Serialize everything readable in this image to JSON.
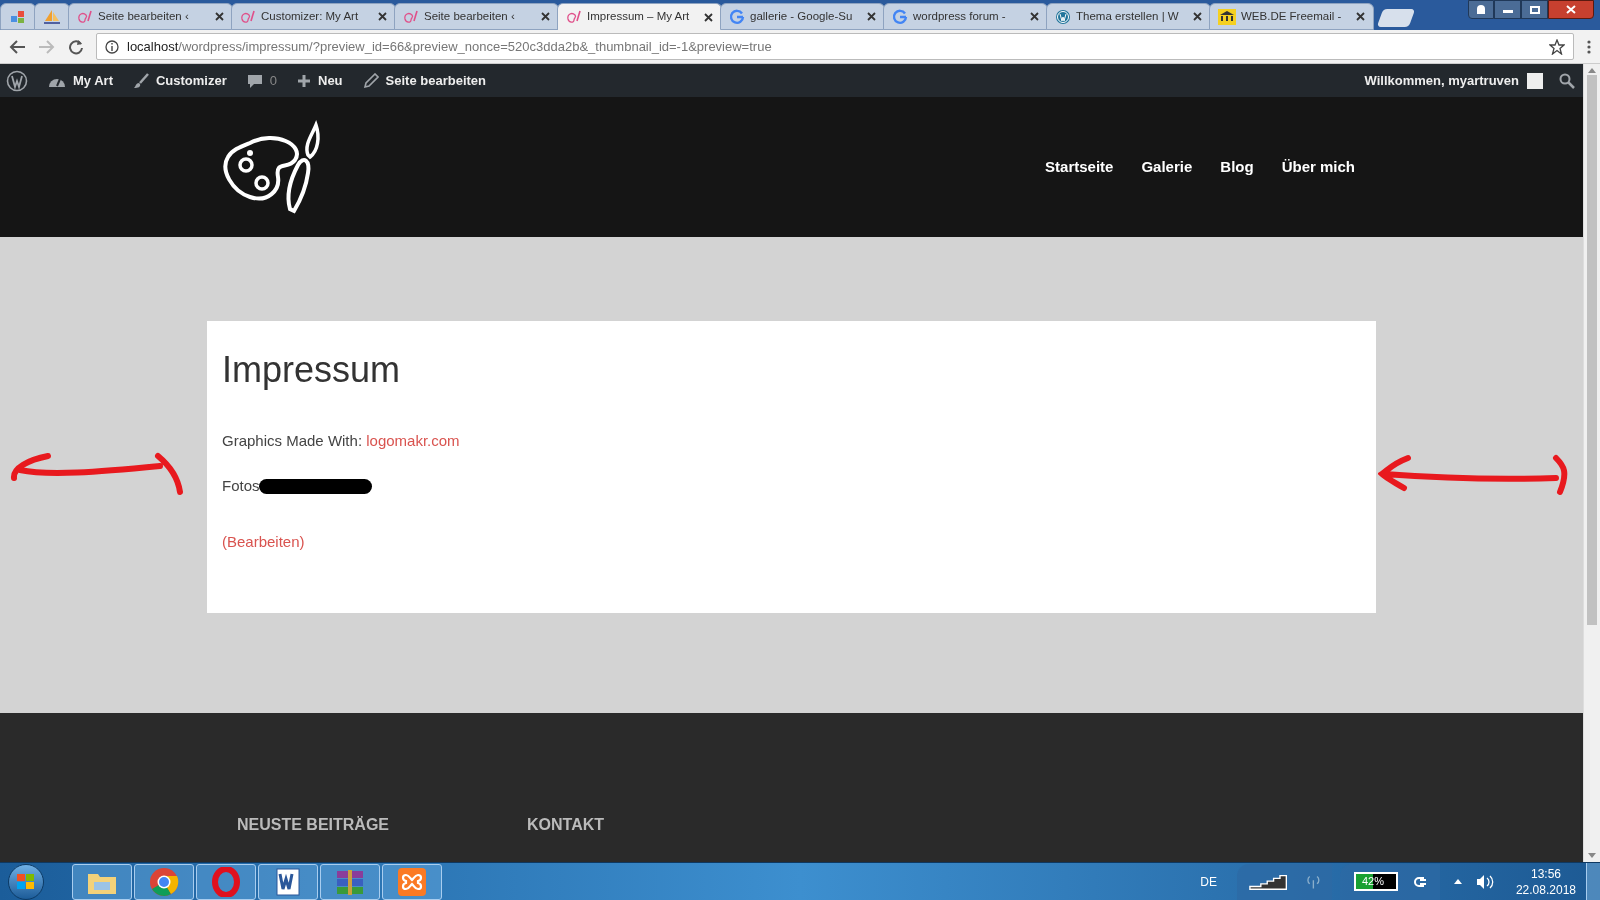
{
  "browser": {
    "tabs": [
      {
        "kind": "apps",
        "selected": false
      },
      {
        "kind": "pma",
        "selected": false
      },
      {
        "kind": "wp-pink",
        "title": "Seite bearbeiten ‹",
        "selected": false
      },
      {
        "kind": "wp-pink",
        "title": "Customizer: My Art",
        "selected": false
      },
      {
        "kind": "wp-pink",
        "title": "Seite bearbeiten ‹",
        "selected": false
      },
      {
        "kind": "wp-pink",
        "title": "Impressum – My Art",
        "selected": true
      },
      {
        "kind": "google",
        "title": "gallerie - Google-Su",
        "selected": false
      },
      {
        "kind": "google",
        "title": "wordpress forum -",
        "selected": false
      },
      {
        "kind": "wordpress",
        "title": "Thema erstellen | W",
        "selected": false
      },
      {
        "kind": "webde",
        "title": "WEB.DE Freemail -",
        "selected": false
      }
    ],
    "address": {
      "host": "localhost",
      "path": "/wordpress/impressum/?preview_id=66&preview_nonce=520c3dda2b&_thumbnail_id=-1&preview=true"
    }
  },
  "admin_bar": {
    "items": [
      {
        "kind": "dashboard",
        "label": "My Art"
      },
      {
        "kind": "brush",
        "label": "Customizer"
      },
      {
        "kind": "comment",
        "label": "0"
      },
      {
        "kind": "plus",
        "label": "Neu"
      },
      {
        "kind": "pencil",
        "label": "Seite bearbeiten"
      }
    ],
    "greeting": "Willkommen, myartruven"
  },
  "site": {
    "nav": [
      "Startseite",
      "Galerie",
      "Blog",
      "Über mich"
    ],
    "page": {
      "title": "Impressum",
      "credit": {
        "text": "Graphics Made With: ",
        "link": "logomakr.com"
      },
      "photos_label": "Fotos",
      "edit_link": "(Bearbeiten)"
    },
    "footer": {
      "headings": [
        "NEUSTE BEITRÄGE",
        "KONTAKT"
      ]
    }
  },
  "taskbar": {
    "apps": [
      {
        "kind": "explorer"
      },
      {
        "kind": "chrome"
      },
      {
        "kind": "opera"
      },
      {
        "kind": "word"
      },
      {
        "kind": "winrar"
      },
      {
        "kind": "xampp"
      }
    ],
    "language": "DE",
    "battery": "42%",
    "time": "13:56",
    "date": "22.08.2018"
  }
}
